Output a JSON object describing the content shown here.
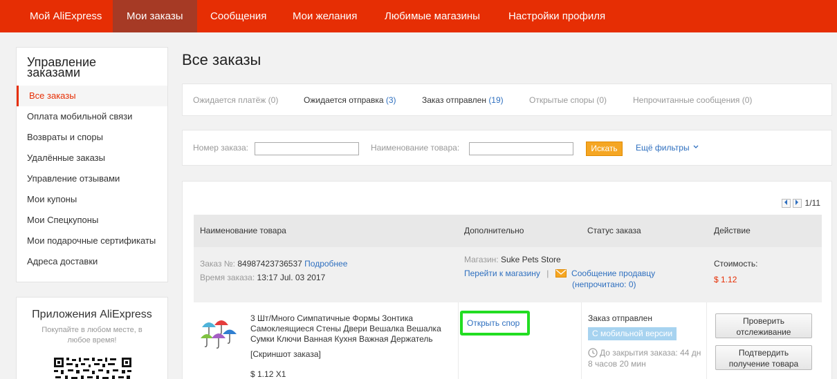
{
  "nav": {
    "items": [
      {
        "label": "Мой AliExpress"
      },
      {
        "label": "Мои заказы"
      },
      {
        "label": "Сообщения"
      },
      {
        "label": "Мои желания"
      },
      {
        "label": "Любимые магазины"
      },
      {
        "label": "Настройки профиля"
      }
    ],
    "active_index": 1
  },
  "sidebar": {
    "title_line1": "Управление",
    "title_line2": "заказами",
    "items": [
      {
        "label": "Все заказы"
      },
      {
        "label": "Оплата мобильной связи"
      },
      {
        "label": "Возвраты и споры"
      },
      {
        "label": "Удалённые заказы"
      },
      {
        "label": "Управление отзывами"
      },
      {
        "label": "Мои купоны"
      },
      {
        "label": "Мои Спецкупоны"
      },
      {
        "label": "Мои подарочные сертификаты"
      },
      {
        "label": "Адреса доставки"
      }
    ],
    "active_index": 0
  },
  "apps": {
    "title": "Приложения AliExpress",
    "subtitle": "Покупайте в любом месте, в любое время!"
  },
  "main": {
    "title": "Все заказы"
  },
  "status_tabs": [
    {
      "label": "Ожидается платёж",
      "count": "(0)"
    },
    {
      "label": "Ожидается отправка",
      "count": "(3)"
    },
    {
      "label": "Заказ отправлен",
      "count": "(19)"
    },
    {
      "label": "Открытые споры",
      "count": "(0)"
    },
    {
      "label": "Непрочитанные сообщения",
      "count": "(0)"
    }
  ],
  "filters": {
    "order_number_label": "Номер заказа:",
    "order_number_value": "",
    "product_name_label": "Наименование товара:",
    "product_name_value": "",
    "search_label": "Искать",
    "more_filters_label": "Ещё фильтры"
  },
  "pager": {
    "text": "1/11"
  },
  "table": {
    "headers": {
      "product": "Наименование товара",
      "extra": "Дополнительно",
      "status": "Статус заказа",
      "action": "Действие"
    }
  },
  "order": {
    "number_label": "Заказ №:",
    "number": "84987423736537",
    "details_link": "Подробнее",
    "time_label": "Время заказа:",
    "time": "13:17 Jul. 03 2017",
    "store_label": "Магазин:",
    "store_name": "Suke Pets Store",
    "go_to_store": "Перейти к магазину",
    "message_seller": "Сообщение продавцу",
    "unread_text": "(непрочитано:",
    "unread_count": "0",
    "unread_close": ")",
    "cost_label": "Стоимость:",
    "cost": "$ 1.12",
    "item": {
      "title": "3 Шт/Много Симпатичные Формы Зонтика Самоклеящиеся Стены Двери Вешалка Вешалка Сумки Ключи Ванная Кухня Важная Держатель",
      "screenshot_link": "[Скриншот заказа]",
      "price_qty": "$ 1.12 X1",
      "dispute_label": "Открыть спор",
      "status_text": "Заказ отправлен",
      "mobile_badge": "С мобильной версии",
      "countdown_text": "До закрытия заказа: 44 дн 8 часов 20 мин",
      "track_button_line1": "Проверить",
      "track_button_line2": "отслеживание",
      "confirm_button_line1": "Подтвердить",
      "confirm_button_line2": "получение товара"
    }
  },
  "colors": {
    "brand_red": "#e62e04",
    "active_nav": "#a63a25",
    "link_blue": "#2e6fbf",
    "search_orange": "#f5a623",
    "highlight_green": "#22dd22",
    "badge_blue": "#a7d3f0"
  }
}
